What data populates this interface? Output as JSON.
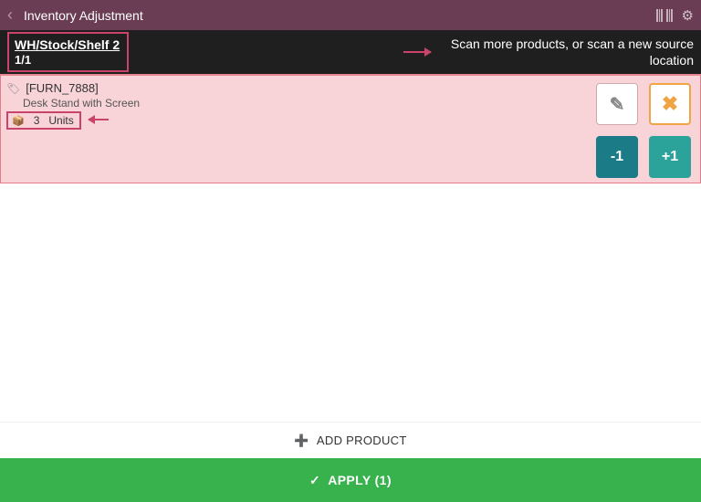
{
  "header": {
    "title": "Inventory Adjustment"
  },
  "subheader": {
    "location": "WH/Stock/Shelf 2",
    "count": "1/1",
    "scan_message": "Scan more products, or scan a new source location"
  },
  "product": {
    "sku": "[FURN_7888]",
    "name": "Desk Stand with Screen",
    "qty": "3",
    "uom": "Units",
    "dec_label": "-1",
    "inc_label": "+1"
  },
  "footer": {
    "add_product_label": "ADD PRODUCT",
    "apply_label": "APPLY (1)"
  }
}
